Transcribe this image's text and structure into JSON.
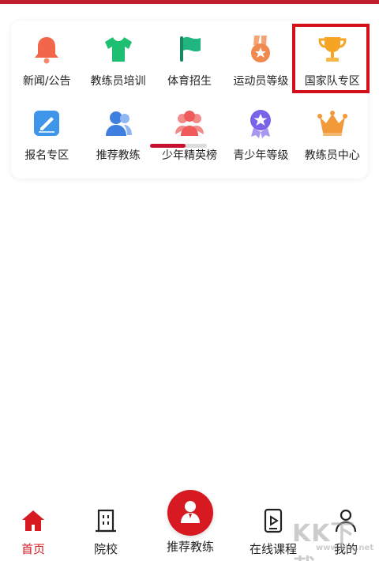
{
  "menu": {
    "row1": [
      {
        "label": "新闻/公告",
        "icon": "bell-icon",
        "color": "#f2664a"
      },
      {
        "label": "教练员培训",
        "icon": "tshirt-icon",
        "color": "#1fbf72"
      },
      {
        "label": "体育招生",
        "icon": "flag-icon",
        "color": "#21b680"
      },
      {
        "label": "运动员等级",
        "icon": "medal-icon",
        "color": "#f0894e"
      },
      {
        "label": "国家队专区",
        "icon": "trophy-icon",
        "color": "#f5a423"
      }
    ],
    "row2": [
      {
        "label": "报名专区",
        "icon": "form-icon",
        "color": "#3f95e8"
      },
      {
        "label": "推荐教练",
        "icon": "users-icon",
        "color": "#3f7fe0"
      },
      {
        "label": "少年精英榜",
        "icon": "group-icon",
        "color": "#ef5b5b"
      },
      {
        "label": "青少年等级",
        "icon": "badge-icon",
        "color": "#7a63e8"
      },
      {
        "label": "教练员中心",
        "icon": "crown-icon",
        "color": "#f29a3a"
      }
    ],
    "page_progress": 0.62
  },
  "tabs": [
    {
      "label": "首页",
      "icon": "home-icon"
    },
    {
      "label": "院校",
      "icon": "building-icon"
    },
    {
      "label": "推荐教练",
      "icon": "coach-icon"
    },
    {
      "label": "在线课程",
      "icon": "video-icon"
    },
    {
      "label": "我的",
      "icon": "person-icon"
    }
  ],
  "watermark": {
    "big": "KK下载",
    "small": "www.kkx.net"
  },
  "colors": {
    "accent": "#d71a21",
    "highlight": "#d3101a"
  }
}
